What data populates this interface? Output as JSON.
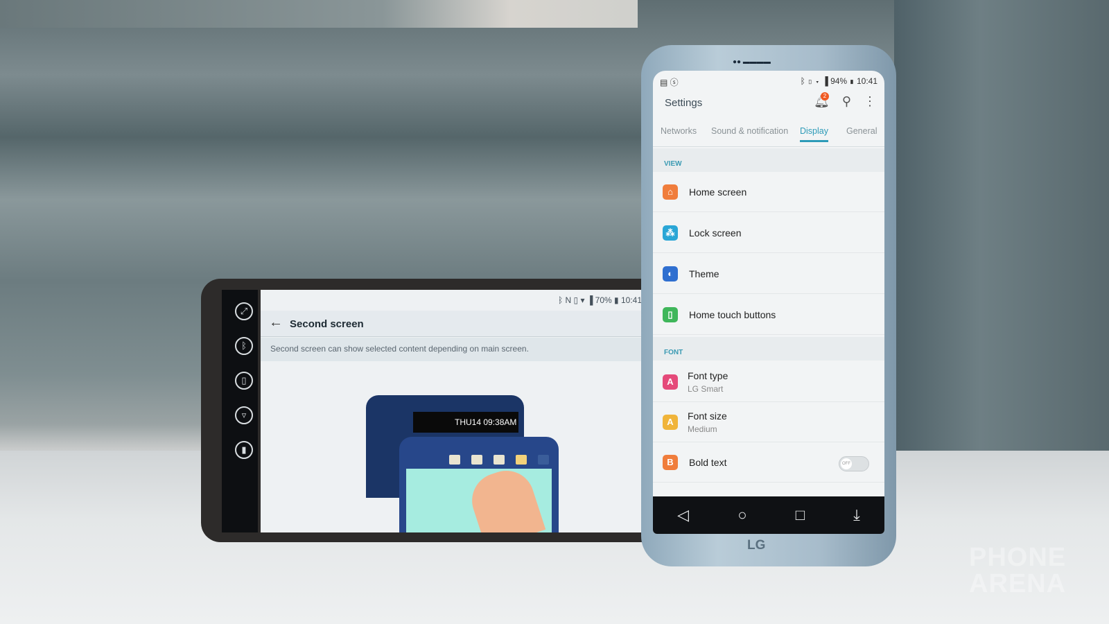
{
  "second_screen": {
    "status": {
      "battery": "70%",
      "time": "10:41"
    },
    "title": "Second screen",
    "description": "Second screen can show selected content depending on main screen.",
    "illustration_clock": "THU14 09:38AM",
    "side_icons": [
      "capture-icon",
      "bluetooth-icon",
      "flashlight-icon",
      "wifi-icon",
      "vibrate-icon"
    ]
  },
  "settings": {
    "status": {
      "battery": "94%",
      "time": "10:41"
    },
    "title": "Settings",
    "notification_count": "2",
    "tabs": [
      {
        "label": "Networks"
      },
      {
        "label": "Sound & notification"
      },
      {
        "label": "Display",
        "active": true
      },
      {
        "label": "General"
      }
    ],
    "sections": [
      {
        "header": "VIEW",
        "items": [
          {
            "label": "Home screen",
            "icon": "home-icon",
            "color": "#f07d3c"
          },
          {
            "label": "Lock screen",
            "icon": "lock-screen-icon",
            "color": "#2aa6d6"
          },
          {
            "label": "Theme",
            "icon": "palette-icon",
            "color": "#2f6fd0"
          },
          {
            "label": "Home touch buttons",
            "icon": "phone-icon",
            "color": "#3fb65a"
          }
        ]
      },
      {
        "header": "FONT",
        "items": [
          {
            "label": "Font type",
            "sub": "LG Smart",
            "icon": "A",
            "color": "#e54a7a"
          },
          {
            "label": "Font size",
            "sub": "Medium",
            "icon": "A",
            "color": "#f0b43a"
          },
          {
            "label": "Bold text",
            "icon": "B",
            "color": "#f07d3c",
            "toggle": "OFF"
          }
        ]
      }
    ]
  },
  "brand": "LG",
  "watermark": "PHONE ARENA"
}
